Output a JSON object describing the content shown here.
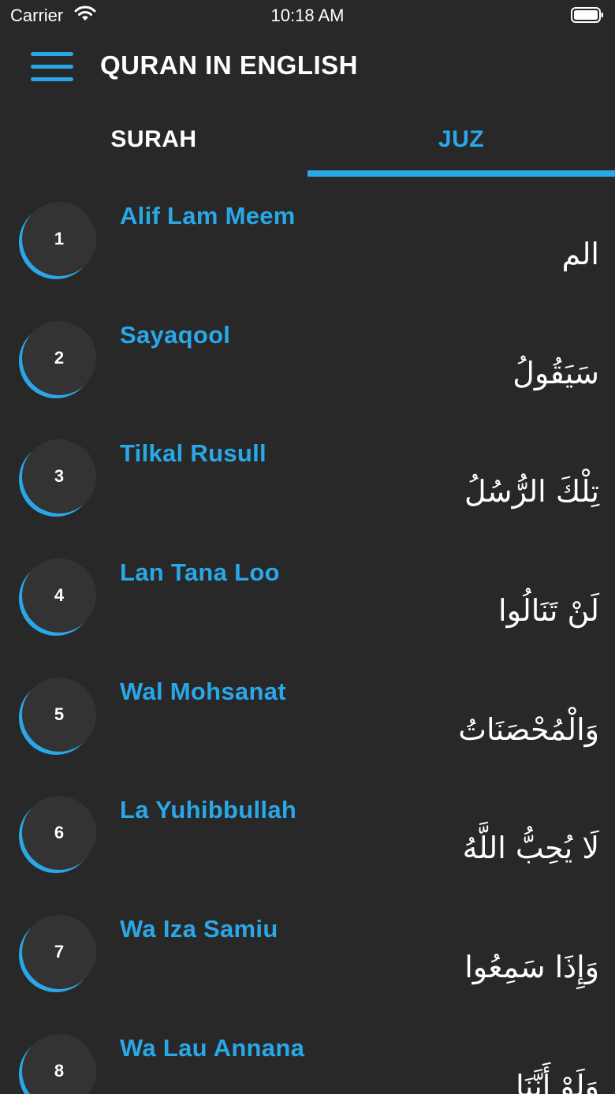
{
  "status_bar": {
    "carrier": "Carrier",
    "time": "10:18 AM",
    "wifi_icon": "wifi-icon",
    "battery_icon": "battery-full-icon"
  },
  "header": {
    "menu_icon": "hamburger-menu-icon",
    "title": "QURAN IN ENGLISH"
  },
  "tabs": [
    {
      "label": "SURAH",
      "active": false
    },
    {
      "label": "JUZ",
      "active": true
    }
  ],
  "colors": {
    "accent": "#29a8e8",
    "background": "#282828",
    "circle": "#333333",
    "text": "#ffffff"
  },
  "juz": [
    {
      "number": "1",
      "name": "Alif Lam Meem",
      "arabic": "الم"
    },
    {
      "number": "2",
      "name": "Sayaqool",
      "arabic": "سَيَقُولُ"
    },
    {
      "number": "3",
      "name": "Tilkal Rusull",
      "arabic": "تِلْكَ الرُّسُلُ"
    },
    {
      "number": "4",
      "name": "Lan Tana Loo",
      "arabic": "لَنْ تَنَالُوا"
    },
    {
      "number": "5",
      "name": "Wal Mohsanat",
      "arabic": "وَالْمُحْصَنَاتُ"
    },
    {
      "number": "6",
      "name": "La Yuhibbullah",
      "arabic": "لَا يُحِبُّ اللَّهُ"
    },
    {
      "number": "7",
      "name": "Wa Iza Samiu",
      "arabic": "وَإِذَا سَمِعُوا"
    },
    {
      "number": "8",
      "name": "Wa Lau Annana",
      "arabic": "وَلَوْ أَنَّنَا"
    }
  ]
}
